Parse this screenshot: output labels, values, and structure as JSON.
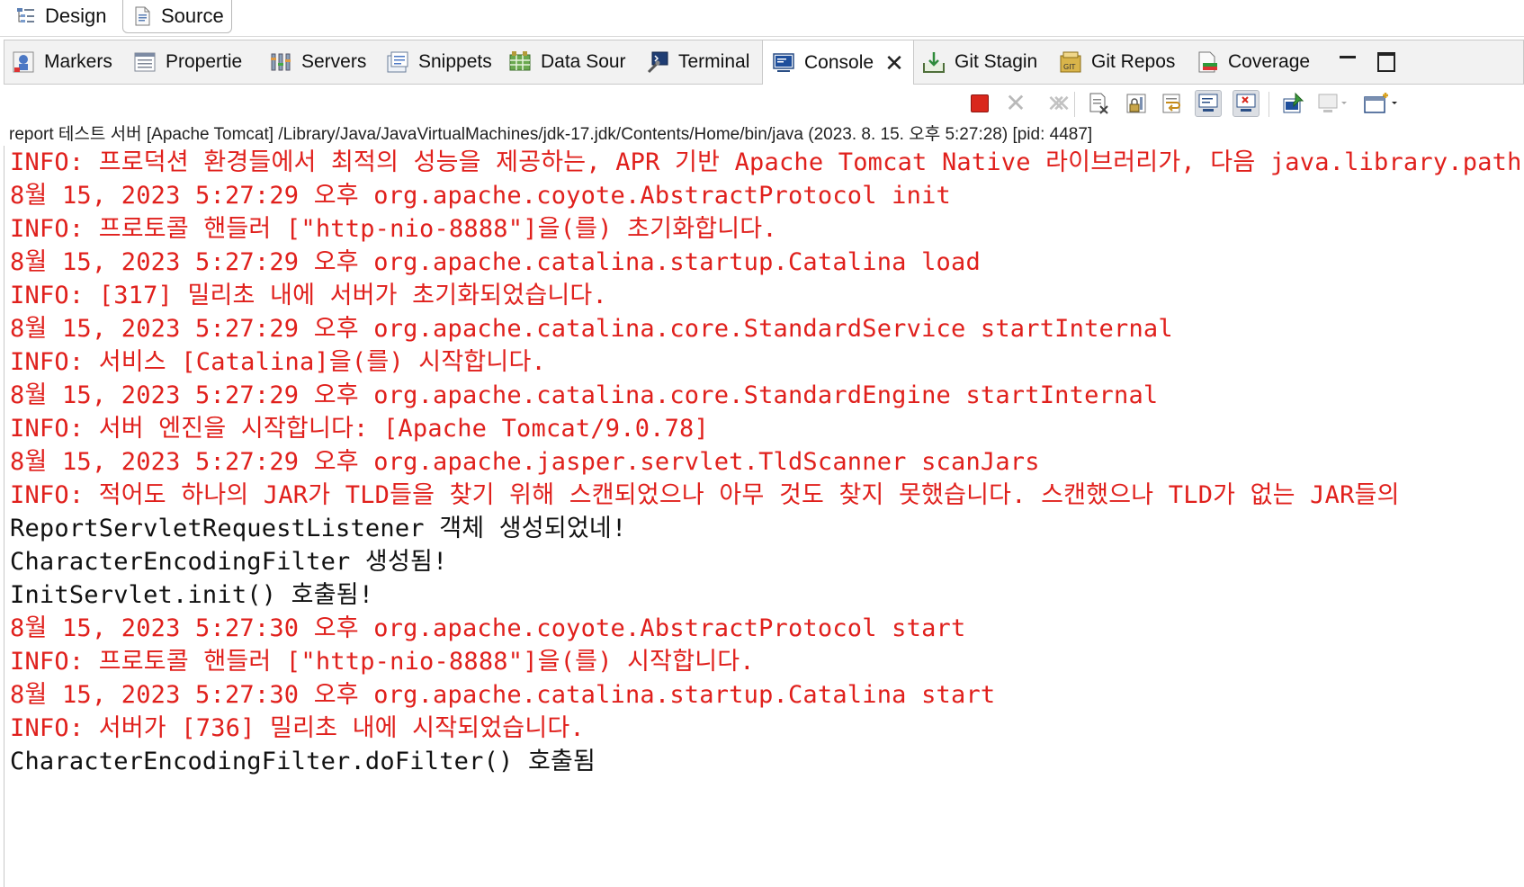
{
  "editor_tabs": [
    {
      "label": "Design",
      "icon": "design-icon"
    },
    {
      "label": "Source",
      "icon": "source-file-icon"
    }
  ],
  "view_tabs": [
    {
      "label": "Markers",
      "icon": "markers-icon"
    },
    {
      "label": "Propertie",
      "icon": "properties-icon"
    },
    {
      "label": "Servers",
      "icon": "servers-icon"
    },
    {
      "label": "Snippets",
      "icon": "snippets-icon"
    },
    {
      "label": "Data Sour",
      "icon": "data-source-icon"
    },
    {
      "label": "Terminal",
      "icon": "terminal-icon"
    },
    {
      "label": "Console",
      "icon": "console-icon",
      "active": true
    },
    {
      "label": "Git Stagin",
      "icon": "git-staging-icon"
    },
    {
      "label": "Git Repos",
      "icon": "git-repos-icon"
    },
    {
      "label": "Coverage",
      "icon": "coverage-icon"
    }
  ],
  "toolbar_icons": [
    "terminate-icon",
    "remove-launch-icon",
    "remove-all-terminated-icon",
    "clear-console-icon",
    "scroll-lock-icon",
    "word-wrap-icon",
    "show-stdout-icon",
    "show-stderr-icon",
    "pin-console-icon",
    "display-console-icon",
    "open-console-icon"
  ],
  "process_line": "report 테스트 서버 [Apache Tomcat] /Library/Java/JavaVirtualMachines/jdk-17.jdk/Contents/Home/bin/java  (2023. 8. 15. 오후 5:27:28) [pid: 4487]",
  "colors": {
    "stderr": "#e0201c",
    "stdout": "#111111"
  },
  "console_lines": [
    {
      "text": "INFO: 프로덕션 환경들에서 최적의 성능을 제공하는, APR 기반 Apache Tomcat Native 라이브러리가, 다음 java.library.path",
      "stream": "stderr"
    },
    {
      "text": "8월 15, 2023 5:27:29 오후 org.apache.coyote.AbstractProtocol init",
      "stream": "stderr"
    },
    {
      "text": "INFO: 프로토콜 핸들러 [\"http-nio-8888\"]을(를) 초기화합니다.",
      "stream": "stderr"
    },
    {
      "text": "8월 15, 2023 5:27:29 오후 org.apache.catalina.startup.Catalina load",
      "stream": "stderr"
    },
    {
      "text": "INFO: [317] 밀리초 내에 서버가 초기화되었습니다.",
      "stream": "stderr"
    },
    {
      "text": "8월 15, 2023 5:27:29 오후 org.apache.catalina.core.StandardService startInternal",
      "stream": "stderr"
    },
    {
      "text": "INFO: 서비스 [Catalina]을(를) 시작합니다.",
      "stream": "stderr"
    },
    {
      "text": "8월 15, 2023 5:27:29 오후 org.apache.catalina.core.StandardEngine startInternal",
      "stream": "stderr"
    },
    {
      "text": "INFO: 서버 엔진을 시작합니다: [Apache Tomcat/9.0.78]",
      "stream": "stderr"
    },
    {
      "text": "8월 15, 2023 5:27:29 오후 org.apache.jasper.servlet.TldScanner scanJars",
      "stream": "stderr"
    },
    {
      "text": "INFO: 적어도 하나의 JAR가 TLD들을 찾기 위해 스캔되었으나 아무 것도 찾지 못했습니다. 스캔했으나 TLD가 없는 JAR들의",
      "stream": "stderr"
    },
    {
      "text": "ReportServletRequestListener 객체 생성되었네!",
      "stream": "stdout"
    },
    {
      "text": "CharacterEncodingFilter 생성됨!",
      "stream": "stdout"
    },
    {
      "text": "InitServlet.init() 호출됨!",
      "stream": "stdout"
    },
    {
      "text": "8월 15, 2023 5:27:30 오후 org.apache.coyote.AbstractProtocol start",
      "stream": "stderr"
    },
    {
      "text": "INFO: 프로토콜 핸들러 [\"http-nio-8888\"]을(를) 시작합니다.",
      "stream": "stderr"
    },
    {
      "text": "8월 15, 2023 5:27:30 오후 org.apache.catalina.startup.Catalina start",
      "stream": "stderr"
    },
    {
      "text": "INFO: 서버가 [736] 밀리초 내에 시작되었습니다.",
      "stream": "stderr"
    },
    {
      "text": "CharacterEncodingFilter.doFilter() 호출됨",
      "stream": "stdout"
    }
  ]
}
